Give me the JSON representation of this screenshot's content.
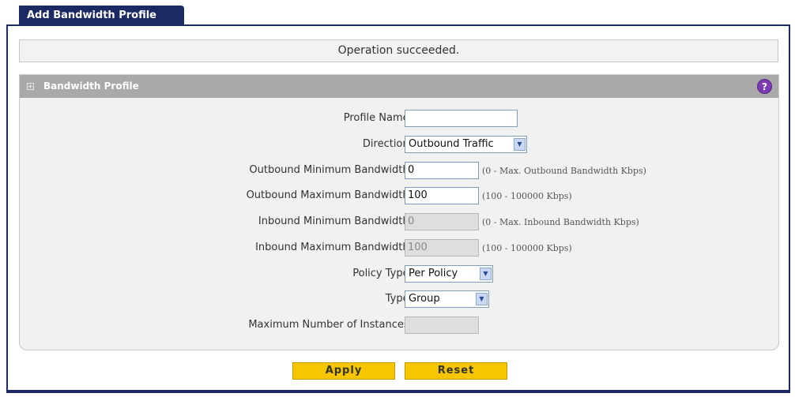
{
  "tab": {
    "label": "Add Bandwidth Profile"
  },
  "status": {
    "message": "Operation succeeded."
  },
  "panel": {
    "title": "Bandwidth Profile",
    "help_icon": "?"
  },
  "form": {
    "profile_name": {
      "label": "Profile Name:",
      "value": ""
    },
    "direction": {
      "label": "Direction:",
      "value": "Outbound Traffic"
    },
    "out_min": {
      "label": "Outbound Minimum Bandwidth:",
      "value": "0",
      "hint": "(0 - Max. Outbound Bandwidth Kbps)"
    },
    "out_max": {
      "label": "Outbound Maximum Bandwidth:",
      "value": "100",
      "hint": "(100 - 100000 Kbps)"
    },
    "in_min": {
      "label": "Inbound Minimum Bandwidth:",
      "value": "0",
      "hint": "(0 - Max. Inbound Bandwidth Kbps)"
    },
    "in_max": {
      "label": "Inbound Maximum Bandwidth:",
      "value": "100",
      "hint": "(100 - 100000 Kbps)"
    },
    "policy_type": {
      "label": "Policy Type:",
      "value": "Per Policy"
    },
    "type": {
      "label": "Type:",
      "value": "Group"
    },
    "max_instances": {
      "label": "Maximum Number of Instances:",
      "value": ""
    }
  },
  "buttons": {
    "apply": "Apply",
    "reset": "Reset"
  },
  "colors": {
    "tab": "#1b2a63",
    "panel_header": "#a9a9a9",
    "button": "#f7c600",
    "help": "#7a3bb0"
  }
}
